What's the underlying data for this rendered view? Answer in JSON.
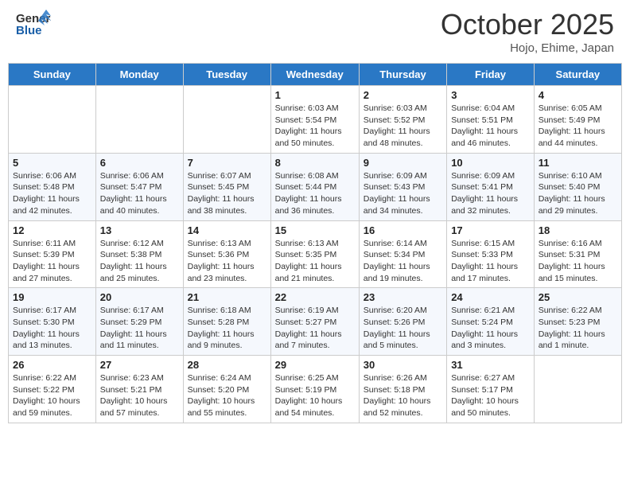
{
  "header": {
    "logo": {
      "line1": "General",
      "line2": "Blue"
    },
    "month": "October 2025",
    "location": "Hojo, Ehime, Japan"
  },
  "weekdays": [
    "Sunday",
    "Monday",
    "Tuesday",
    "Wednesday",
    "Thursday",
    "Friday",
    "Saturday"
  ],
  "weeks": [
    [
      {
        "day": "",
        "sunrise": "",
        "sunset": "",
        "daylight": ""
      },
      {
        "day": "",
        "sunrise": "",
        "sunset": "",
        "daylight": ""
      },
      {
        "day": "",
        "sunrise": "",
        "sunset": "",
        "daylight": ""
      },
      {
        "day": "1",
        "sunrise": "Sunrise: 6:03 AM",
        "sunset": "Sunset: 5:54 PM",
        "daylight": "Daylight: 11 hours and 50 minutes."
      },
      {
        "day": "2",
        "sunrise": "Sunrise: 6:03 AM",
        "sunset": "Sunset: 5:52 PM",
        "daylight": "Daylight: 11 hours and 48 minutes."
      },
      {
        "day": "3",
        "sunrise": "Sunrise: 6:04 AM",
        "sunset": "Sunset: 5:51 PM",
        "daylight": "Daylight: 11 hours and 46 minutes."
      },
      {
        "day": "4",
        "sunrise": "Sunrise: 6:05 AM",
        "sunset": "Sunset: 5:49 PM",
        "daylight": "Daylight: 11 hours and 44 minutes."
      }
    ],
    [
      {
        "day": "5",
        "sunrise": "Sunrise: 6:06 AM",
        "sunset": "Sunset: 5:48 PM",
        "daylight": "Daylight: 11 hours and 42 minutes."
      },
      {
        "day": "6",
        "sunrise": "Sunrise: 6:06 AM",
        "sunset": "Sunset: 5:47 PM",
        "daylight": "Daylight: 11 hours and 40 minutes."
      },
      {
        "day": "7",
        "sunrise": "Sunrise: 6:07 AM",
        "sunset": "Sunset: 5:45 PM",
        "daylight": "Daylight: 11 hours and 38 minutes."
      },
      {
        "day": "8",
        "sunrise": "Sunrise: 6:08 AM",
        "sunset": "Sunset: 5:44 PM",
        "daylight": "Daylight: 11 hours and 36 minutes."
      },
      {
        "day": "9",
        "sunrise": "Sunrise: 6:09 AM",
        "sunset": "Sunset: 5:43 PM",
        "daylight": "Daylight: 11 hours and 34 minutes."
      },
      {
        "day": "10",
        "sunrise": "Sunrise: 6:09 AM",
        "sunset": "Sunset: 5:41 PM",
        "daylight": "Daylight: 11 hours and 32 minutes."
      },
      {
        "day": "11",
        "sunrise": "Sunrise: 6:10 AM",
        "sunset": "Sunset: 5:40 PM",
        "daylight": "Daylight: 11 hours and 29 minutes."
      }
    ],
    [
      {
        "day": "12",
        "sunrise": "Sunrise: 6:11 AM",
        "sunset": "Sunset: 5:39 PM",
        "daylight": "Daylight: 11 hours and 27 minutes."
      },
      {
        "day": "13",
        "sunrise": "Sunrise: 6:12 AM",
        "sunset": "Sunset: 5:38 PM",
        "daylight": "Daylight: 11 hours and 25 minutes."
      },
      {
        "day": "14",
        "sunrise": "Sunrise: 6:13 AM",
        "sunset": "Sunset: 5:36 PM",
        "daylight": "Daylight: 11 hours and 23 minutes."
      },
      {
        "day": "15",
        "sunrise": "Sunrise: 6:13 AM",
        "sunset": "Sunset: 5:35 PM",
        "daylight": "Daylight: 11 hours and 21 minutes."
      },
      {
        "day": "16",
        "sunrise": "Sunrise: 6:14 AM",
        "sunset": "Sunset: 5:34 PM",
        "daylight": "Daylight: 11 hours and 19 minutes."
      },
      {
        "day": "17",
        "sunrise": "Sunrise: 6:15 AM",
        "sunset": "Sunset: 5:33 PM",
        "daylight": "Daylight: 11 hours and 17 minutes."
      },
      {
        "day": "18",
        "sunrise": "Sunrise: 6:16 AM",
        "sunset": "Sunset: 5:31 PM",
        "daylight": "Daylight: 11 hours and 15 minutes."
      }
    ],
    [
      {
        "day": "19",
        "sunrise": "Sunrise: 6:17 AM",
        "sunset": "Sunset: 5:30 PM",
        "daylight": "Daylight: 11 hours and 13 minutes."
      },
      {
        "day": "20",
        "sunrise": "Sunrise: 6:17 AM",
        "sunset": "Sunset: 5:29 PM",
        "daylight": "Daylight: 11 hours and 11 minutes."
      },
      {
        "day": "21",
        "sunrise": "Sunrise: 6:18 AM",
        "sunset": "Sunset: 5:28 PM",
        "daylight": "Daylight: 11 hours and 9 minutes."
      },
      {
        "day": "22",
        "sunrise": "Sunrise: 6:19 AM",
        "sunset": "Sunset: 5:27 PM",
        "daylight": "Daylight: 11 hours and 7 minutes."
      },
      {
        "day": "23",
        "sunrise": "Sunrise: 6:20 AM",
        "sunset": "Sunset: 5:26 PM",
        "daylight": "Daylight: 11 hours and 5 minutes."
      },
      {
        "day": "24",
        "sunrise": "Sunrise: 6:21 AM",
        "sunset": "Sunset: 5:24 PM",
        "daylight": "Daylight: 11 hours and 3 minutes."
      },
      {
        "day": "25",
        "sunrise": "Sunrise: 6:22 AM",
        "sunset": "Sunset: 5:23 PM",
        "daylight": "Daylight: 11 hours and 1 minute."
      }
    ],
    [
      {
        "day": "26",
        "sunrise": "Sunrise: 6:22 AM",
        "sunset": "Sunset: 5:22 PM",
        "daylight": "Daylight: 10 hours and 59 minutes."
      },
      {
        "day": "27",
        "sunrise": "Sunrise: 6:23 AM",
        "sunset": "Sunset: 5:21 PM",
        "daylight": "Daylight: 10 hours and 57 minutes."
      },
      {
        "day": "28",
        "sunrise": "Sunrise: 6:24 AM",
        "sunset": "Sunset: 5:20 PM",
        "daylight": "Daylight: 10 hours and 55 minutes."
      },
      {
        "day": "29",
        "sunrise": "Sunrise: 6:25 AM",
        "sunset": "Sunset: 5:19 PM",
        "daylight": "Daylight: 10 hours and 54 minutes."
      },
      {
        "day": "30",
        "sunrise": "Sunrise: 6:26 AM",
        "sunset": "Sunset: 5:18 PM",
        "daylight": "Daylight: 10 hours and 52 minutes."
      },
      {
        "day": "31",
        "sunrise": "Sunrise: 6:27 AM",
        "sunset": "Sunset: 5:17 PM",
        "daylight": "Daylight: 10 hours and 50 minutes."
      },
      {
        "day": "",
        "sunrise": "",
        "sunset": "",
        "daylight": ""
      }
    ]
  ]
}
